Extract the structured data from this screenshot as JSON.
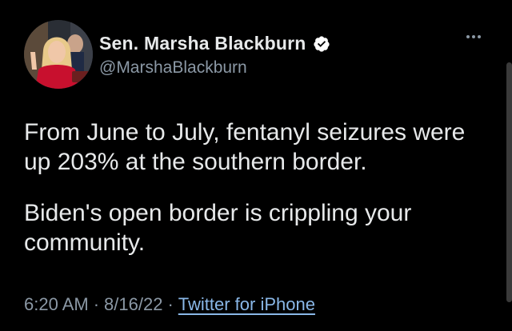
{
  "author": {
    "display_name": "Sen. Marsha Blackburn",
    "handle": "@MarshaBlackburn",
    "verified": true,
    "avatar_icon": "profile-photo"
  },
  "tweet": {
    "paragraphs": [
      "From June to July, fentanyl seizures were up 203% at the southern border.",
      "Biden's open border is crippling your community."
    ],
    "time": "6:20 AM",
    "separator": "·",
    "date": "8/16/22",
    "source": "Twitter for iPhone"
  },
  "icons": {
    "more": "more-horizontal-icon",
    "verified": "verified-badge-icon"
  },
  "colors": {
    "background": "#000000",
    "text": "#e7e9ea",
    "secondary": "#8b98a5",
    "link": "#8ab8e8",
    "verified_badge": "#ffffff"
  }
}
